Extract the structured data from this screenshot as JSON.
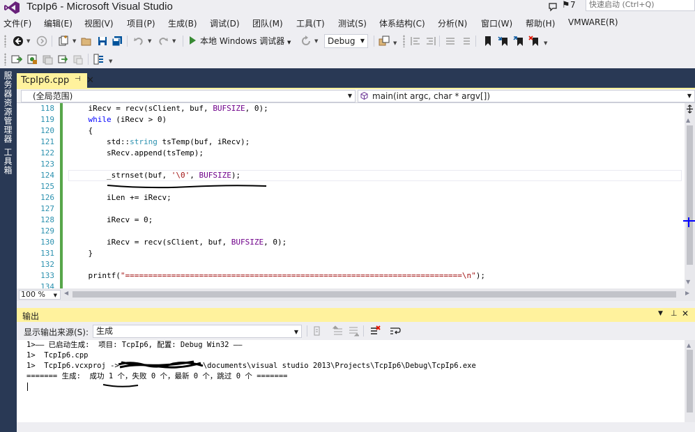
{
  "window": {
    "title": "TcpIp6 - Microsoft Visual Studio",
    "notification_count": "7",
    "quick_launch_placeholder": "快速启动 (Ctrl+Q)"
  },
  "menu": [
    "文件(F)",
    "编辑(E)",
    "视图(V)",
    "项目(P)",
    "生成(B)",
    "调试(D)",
    "团队(M)",
    "工具(T)",
    "测试(S)",
    "体系结构(C)",
    "分析(N)",
    "窗口(W)",
    "帮助(H)",
    "VMWARE(R)"
  ],
  "toolbar": {
    "debugger_label": "本地 Windows 调试器",
    "configuration": "Debug"
  },
  "side_tabs": [
    "服务器资源管理器",
    "工具箱"
  ],
  "document_tab": {
    "filename": "TcpIp6.cpp",
    "pin_glyph": "⊣",
    "close_glyph": "✕"
  },
  "navigation": {
    "scope": "(全局范围)",
    "member": "main(int argc, char * argv[])"
  },
  "editor": {
    "zoom": "100 %",
    "lines": [
      {
        "no": "118",
        "text": "    iRecv = recv(sClient, buf, BUFSIZE, 0);"
      },
      {
        "no": "119",
        "text": "    while (iRecv > 0)"
      },
      {
        "no": "120",
        "text": "    {"
      },
      {
        "no": "121",
        "text": "        std::string tsTemp(buf, iRecv);"
      },
      {
        "no": "122",
        "text": "        sRecv.append(tsTemp);"
      },
      {
        "no": "123",
        "text": ""
      },
      {
        "no": "124",
        "text": "        _strnset(buf, '\\0', BUFSIZE);"
      },
      {
        "no": "125",
        "text": ""
      },
      {
        "no": "126",
        "text": "        iLen += iRecv;"
      },
      {
        "no": "127",
        "text": ""
      },
      {
        "no": "128",
        "text": "        iRecv = 0;"
      },
      {
        "no": "129",
        "text": ""
      },
      {
        "no": "130",
        "text": "        iRecv = recv(sClient, buf, BUFSIZE, 0);"
      },
      {
        "no": "131",
        "text": "    }"
      },
      {
        "no": "132",
        "text": ""
      },
      {
        "no": "133",
        "text": "    printf(\"=========================================================================\\n\");"
      },
      {
        "no": "134",
        "text": ""
      }
    ]
  },
  "output": {
    "title": "输出",
    "source_label": "显示输出来源(S):",
    "source_value": "生成",
    "lines": [
      "1>—— 已启动生成:  项目: TcpIp6, 配置: Debug Win32 ——",
      "1>  TcpIp6.cpp",
      "1>  TcpIp6.vcxproj ->                   \\documents\\visual studio 2013\\Projects\\TcpIp6\\Debug\\TcpIp6.exe",
      "======= 生成:  成功 1 个，失败 0 个，最新 0 个，跳过 0 个 ======="
    ]
  },
  "colors": {
    "accent_tab": "#fff29d",
    "side_strip": "#293955",
    "line_number": "#2b91af",
    "keyword": "#0000ff",
    "macro": "#6f008a",
    "string": "#a31515",
    "change_bar": "#57a64a"
  }
}
